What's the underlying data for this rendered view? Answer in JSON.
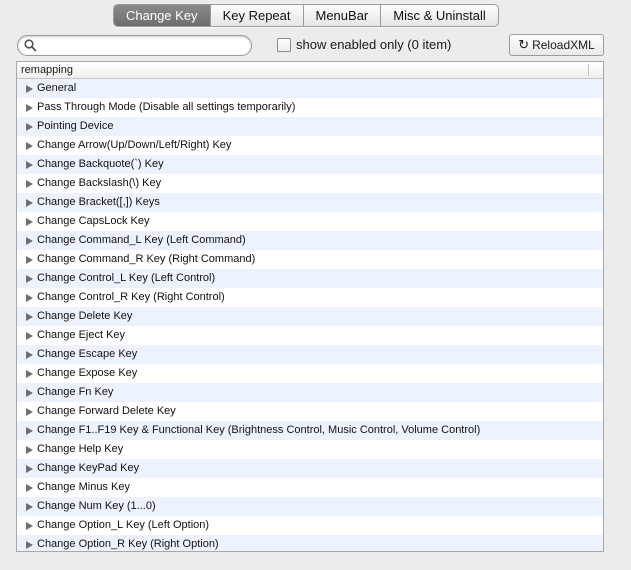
{
  "tabs": [
    "Change Key",
    "Key Repeat",
    "MenuBar",
    "Misc & Uninstall"
  ],
  "active_tab": "Change Key",
  "search": {
    "value": "",
    "placeholder": ""
  },
  "filter": {
    "label": "show enabled only (0 item)",
    "checked": false
  },
  "reload_button": {
    "label": "ReloadXML",
    "icon": "refresh-icon"
  },
  "table": {
    "header": "remapping",
    "rows": [
      "General",
      "Pass Through Mode (Disable all settings temporarily)",
      "Pointing Device",
      "Change Arrow(Up/Down/Left/Right) Key",
      "Change Backquote(`) Key",
      "Change Backslash(\\) Key",
      "Change Bracket([,]) Keys",
      "Change CapsLock Key",
      "Change Command_L Key (Left Command)",
      "Change Command_R Key (Right Command)",
      "Change Control_L Key (Left Control)",
      "Change Control_R Key (Right Control)",
      "Change Delete Key",
      "Change Eject Key",
      "Change Escape Key",
      "Change Expose Key",
      "Change Fn Key",
      "Change Forward Delete Key",
      "Change F1..F19 Key & Functional Key (Brightness Control, Music Control, Volume Control)",
      "Change Help Key",
      "Change KeyPad Key",
      "Change Minus Key",
      "Change Num Key (1...0)",
      "Change Option_L Key (Left Option)",
      "Change Option_R Key (Right Option)"
    ]
  },
  "colors": {
    "row_alt": "#edf3fe",
    "active_tab": "#7a7a7a",
    "background": "#ececec"
  }
}
